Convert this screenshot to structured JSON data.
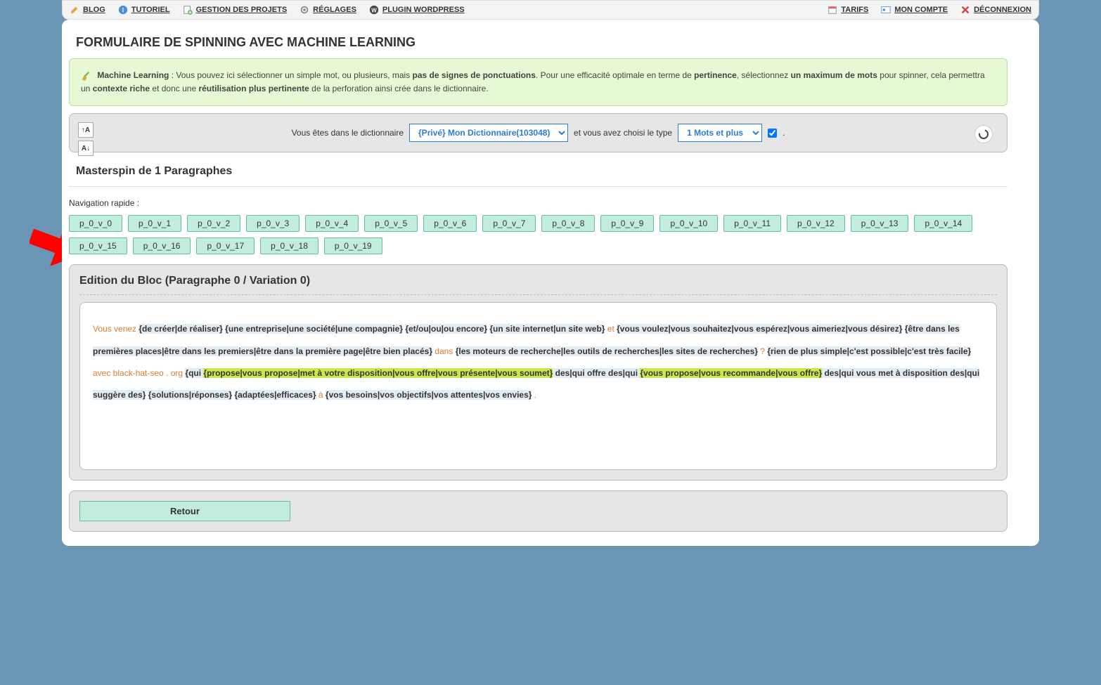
{
  "topbar": {
    "left": {
      "blog": "BLOG",
      "tutoriel": "TUTORIEL",
      "gestion": "GESTION DES PROJETS",
      "reglages": "RÉGLAGES",
      "plugin": "PLUGIN WORDPRESS"
    },
    "right": {
      "tarifs": "TARIFS",
      "compte": "MON COMPTE",
      "deconnexion": "DÉCONNEXION"
    }
  },
  "page_title": "FORMULAIRE DE SPINNING AVEC MACHINE LEARNING",
  "ml_info": {
    "label": "Machine Learning",
    "t1": " : Vous pouvez ici sélectionner un simple mot, ou plusieurs, mais ",
    "b1": "pas de signes de ponctuations",
    "t2": ". Pour une efficacité optimale en terme de ",
    "b2": "pertinence",
    "t3": ", sélectionnez ",
    "b3": "un maximum de mots",
    "t4": " pour spinner, cela permettra un ",
    "b4": "contexte riche",
    "t5": " et donc une ",
    "b5": "réutilisation plus pertinente",
    "t6": " de la perforation ainsi crée dans le dictionnaire."
  },
  "controls": {
    "before_dict": "Vous êtes dans le dictionnaire",
    "dict_selected": "{Privé} Mon Dictionnaire(103048)",
    "before_type": "et vous avez choisi le type",
    "type_selected": "1 Mots et plus",
    "dot": "."
  },
  "section_title": "Masterspin de 1 Paragraphes",
  "quicknav_label": "Navigation rapide :",
  "pills": [
    "p_0_v_0",
    "p_0_v_1",
    "p_0_v_2",
    "p_0_v_3",
    "p_0_v_4",
    "p_0_v_5",
    "p_0_v_6",
    "p_0_v_7",
    "p_0_v_8",
    "p_0_v_9",
    "p_0_v_10",
    "p_0_v_11",
    "p_0_v_12",
    "p_0_v_13",
    "p_0_v_14",
    "p_0_v_15",
    "p_0_v_16",
    "p_0_v_17",
    "p_0_v_18",
    "p_0_v_19"
  ],
  "edit_title": "Edition du Bloc (Paragraphe 0 / Variation 0)",
  "content": {
    "o1": "Vous venez ",
    "s1": "{de créer|de réaliser}",
    "sp1": " ",
    "s2": "{une entreprise|une société|une compagnie}",
    "sp2": " ",
    "s3": "{et/ou|ou|ou encore}",
    "sp3": " ",
    "s4": "{un site internet|un site web}",
    "sp4": " ",
    "o2": "et ",
    "s5": "{vous voulez|vous souhaitez|vous espérez|vous aimeriez|vous désirez}",
    "sp5": " ",
    "s6": "{être dans les premières places|être dans les premiers|être dans la première page|être bien placés}",
    "sp6": " ",
    "o3": "dans ",
    "s7": "{les moteurs de recherche|les outils de recherches|les sites de recherches}",
    "sp7": " ",
    "o4": "? ",
    "s8": "{rien de plus simple|c'est possible|c'est très facile}",
    "sp8": " ",
    "o5": "avec black-hat-seo . org ",
    "s9": "{qui ",
    "h1": "{propose|vous propose|met à votre disposition|vous offre|vous présente|vous soumet}",
    "s10": " des|qui offre des|qui ",
    "h2": "{vous propose|vous recommande|vous offre}",
    "s11": " des|qui vous met à disposition des|qui suggère des}",
    "sp9": " ",
    "s12": "{solutions|réponses}",
    "sp10": " ",
    "s13": "{adaptées|efficaces}",
    "sp11": " ",
    "o6": "à ",
    "s14": "{vos besoins|vos objectifs|vos attentes|vos envies}",
    "o7": " ."
  },
  "retour": "Retour"
}
